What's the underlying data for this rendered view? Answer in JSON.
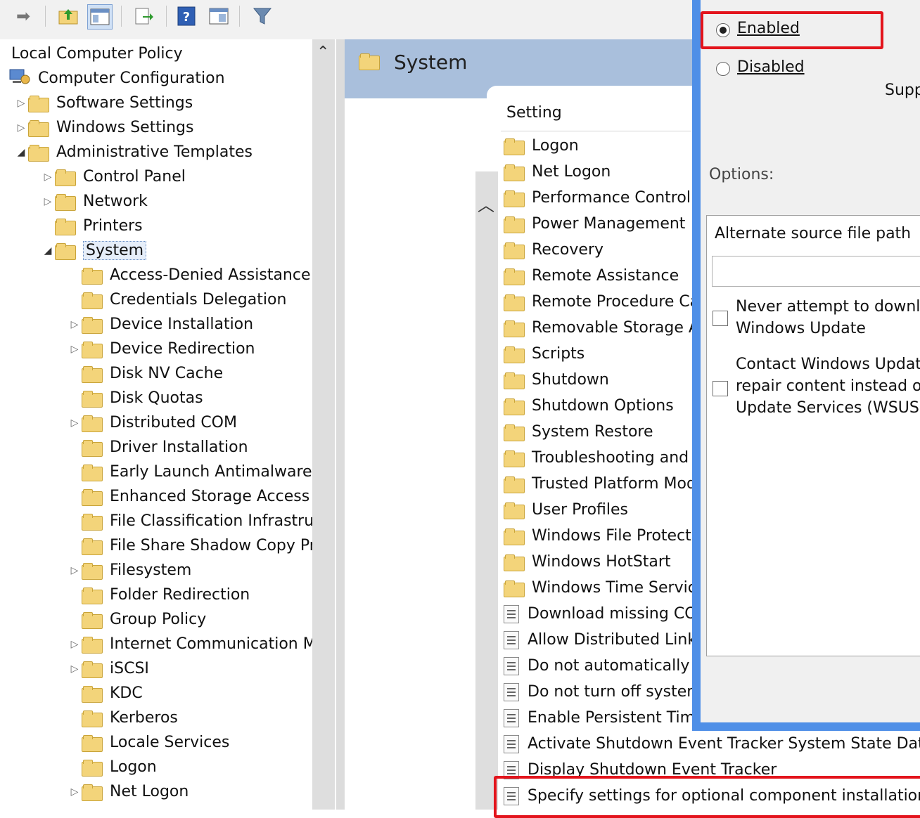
{
  "toolbar": {
    "icons": [
      "back-arrow-icon",
      "up-folder-icon",
      "show-hide-tree-icon",
      "export-list-icon",
      "help-icon",
      "properties-icon",
      "filter-icon"
    ]
  },
  "tree": {
    "root": "Local Computer Policy",
    "computer_configuration": "Computer Configuration",
    "items": [
      {
        "label": "Software Settings",
        "expander": "closed"
      },
      {
        "label": "Windows Settings",
        "expander": "closed"
      },
      {
        "label": "Administrative Templates",
        "expander": "open"
      },
      {
        "label": "Control Panel",
        "expander": "closed"
      },
      {
        "label": "Network",
        "expander": "closed"
      },
      {
        "label": "Printers",
        "expander": "none"
      },
      {
        "label": "System",
        "expander": "open"
      },
      {
        "label": "Access-Denied Assistance",
        "expander": "none"
      },
      {
        "label": "Credentials Delegation",
        "expander": "none"
      },
      {
        "label": "Device Installation",
        "expander": "closed"
      },
      {
        "label": "Device Redirection",
        "expander": "closed"
      },
      {
        "label": "Disk NV Cache",
        "expander": "none"
      },
      {
        "label": "Disk Quotas",
        "expander": "none"
      },
      {
        "label": "Distributed COM",
        "expander": "closed"
      },
      {
        "label": "Driver Installation",
        "expander": "none"
      },
      {
        "label": "Early Launch Antimalware",
        "expander": "none"
      },
      {
        "label": "Enhanced Storage Access",
        "expander": "none"
      },
      {
        "label": "File Classification Infrastru",
        "expander": "none"
      },
      {
        "label": "File Share Shadow Copy Pr",
        "expander": "none"
      },
      {
        "label": "Filesystem",
        "expander": "closed"
      },
      {
        "label": "Folder Redirection",
        "expander": "none"
      },
      {
        "label": "Group Policy",
        "expander": "none"
      },
      {
        "label": "Internet Communication M",
        "expander": "closed"
      },
      {
        "label": "iSCSI",
        "expander": "closed"
      },
      {
        "label": "KDC",
        "expander": "none"
      },
      {
        "label": "Kerberos",
        "expander": "none"
      },
      {
        "label": "Locale Services",
        "expander": "none"
      },
      {
        "label": "Logon",
        "expander": "none"
      },
      {
        "label": "Net Logon",
        "expander": "closed"
      }
    ]
  },
  "main": {
    "title": "System",
    "column_header": "Setting",
    "folders": [
      "Logon",
      "Net Logon",
      "Performance Control",
      "Power Management",
      "Recovery",
      "Remote Assistance",
      "Remote Procedure Ca",
      "Removable Storage Ac",
      "Scripts",
      "Shutdown",
      "Shutdown Options",
      "System Restore",
      "Troubleshooting and",
      "Trusted Platform Mod",
      "User Profiles",
      "Windows File Protecti",
      "Windows HotStart",
      "Windows Time Servic"
    ],
    "policies": [
      "Download missing CO",
      "Allow Distributed Link",
      "Do not automatically",
      "Do not turn off system",
      "Enable Persistent Time",
      "Activate Shutdown Event Tracker System State Data f",
      "Display Shutdown Event Tracker",
      "Specify settings for optional component installation a"
    ]
  },
  "dialog": {
    "enabled_label": "Enabled",
    "disabled_label": "Disabled",
    "selected": "enabled",
    "supported_label": "Supp",
    "options_label": "Options:",
    "alt_path_label": "Alternate source file path",
    "alt_path_value": "",
    "never_attempt_line1": "Never attempt to downlo",
    "never_attempt_line2": "Windows Update",
    "contact_line1": "Contact Windows Update",
    "contact_line2": "repair content instead of",
    "contact_line3": "Update Services (WSUS)"
  },
  "colors": {
    "highlight_red": "#e3141c",
    "dialog_border": "#4f8fe7",
    "header_band": "#a9bfdc"
  }
}
